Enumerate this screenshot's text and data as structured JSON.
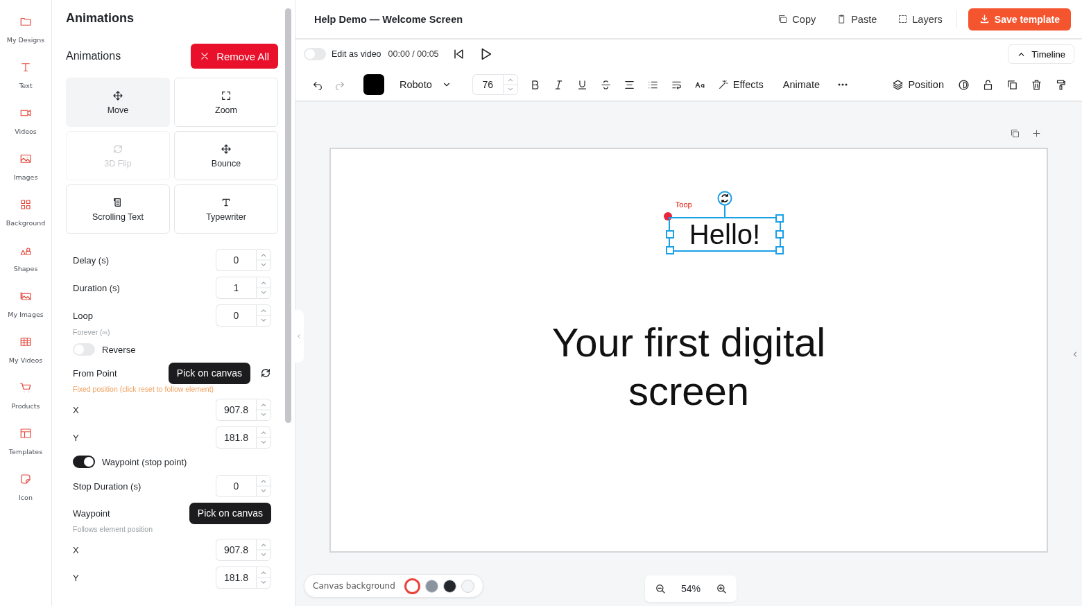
{
  "nav": {
    "items": [
      {
        "label": "My Designs"
      },
      {
        "label": "Text"
      },
      {
        "label": "Videos"
      },
      {
        "label": "Images"
      },
      {
        "label": "Background"
      },
      {
        "label": "Shapes"
      },
      {
        "label": "My Images"
      },
      {
        "label": "My Videos"
      },
      {
        "label": "Products"
      },
      {
        "label": "Templates"
      },
      {
        "label": "Icon"
      }
    ]
  },
  "panel": {
    "title": "Animations",
    "section_title": "Animations",
    "remove_all": "Remove All",
    "animations": [
      {
        "label": "Move",
        "selected": true,
        "disabled": false
      },
      {
        "label": "Zoom",
        "selected": false,
        "disabled": false
      },
      {
        "label": "3D Flip",
        "selected": false,
        "disabled": true
      },
      {
        "label": "Bounce",
        "selected": false,
        "disabled": false
      },
      {
        "label": "Scrolling Text",
        "selected": false,
        "disabled": false
      },
      {
        "label": "Typewriter",
        "selected": false,
        "disabled": false
      }
    ],
    "fields": [
      {
        "kind": "number",
        "label": "Delay (s)",
        "value": "0"
      },
      {
        "kind": "number",
        "label": "Duration (s)",
        "value": "1"
      },
      {
        "kind": "number",
        "label": "Loop",
        "value": "0"
      },
      {
        "kind": "hint",
        "text": "Forever (∞)"
      },
      {
        "kind": "toggle",
        "label": "Reverse",
        "on": false
      },
      {
        "kind": "pick",
        "label": "From Point",
        "button": "Pick on canvas",
        "reset": true
      },
      {
        "kind": "warning",
        "text": "Fixed position (click reset to follow element)"
      },
      {
        "kind": "number",
        "label": "X",
        "value": "907.8"
      },
      {
        "kind": "number",
        "label": "Y",
        "value": "181.8"
      },
      {
        "kind": "toggle",
        "label": "Waypoint (stop point)",
        "on": true
      },
      {
        "kind": "number",
        "label": "Stop Duration (s)",
        "value": "0"
      },
      {
        "kind": "pick",
        "label": "Waypoint",
        "button": "Pick on canvas",
        "reset": false
      },
      {
        "kind": "hint",
        "text": "Follows element position"
      },
      {
        "kind": "number",
        "label": "X",
        "value": "907.8"
      },
      {
        "kind": "number",
        "label": "Y",
        "value": "181.8"
      }
    ]
  },
  "header": {
    "title": "Help Demo — Welcome Screen",
    "actions": [
      "Copy",
      "Paste",
      "Layers"
    ],
    "save": "Save template"
  },
  "playback": {
    "edit_as_video": false,
    "label": "Edit as video",
    "time": "00:00 / 00:05",
    "timeline": "Timeline"
  },
  "toolbar": {
    "font": "Roboto",
    "font_size": "76",
    "effects": "Effects",
    "animate": "Animate",
    "position": "Position"
  },
  "canvas": {
    "selection_label": "Toop",
    "selected_text": "Hello!",
    "text": "Your first digital screen"
  },
  "background_bar": {
    "label": "Canvas background",
    "swatches": [
      {
        "color": "#ffffff",
        "selected": true
      },
      {
        "color": "#8a949f",
        "selected": false
      },
      {
        "color": "#24272c",
        "selected": false
      },
      {
        "color": "#f3f5f7",
        "selected": false
      }
    ]
  },
  "zoom": "54%"
}
